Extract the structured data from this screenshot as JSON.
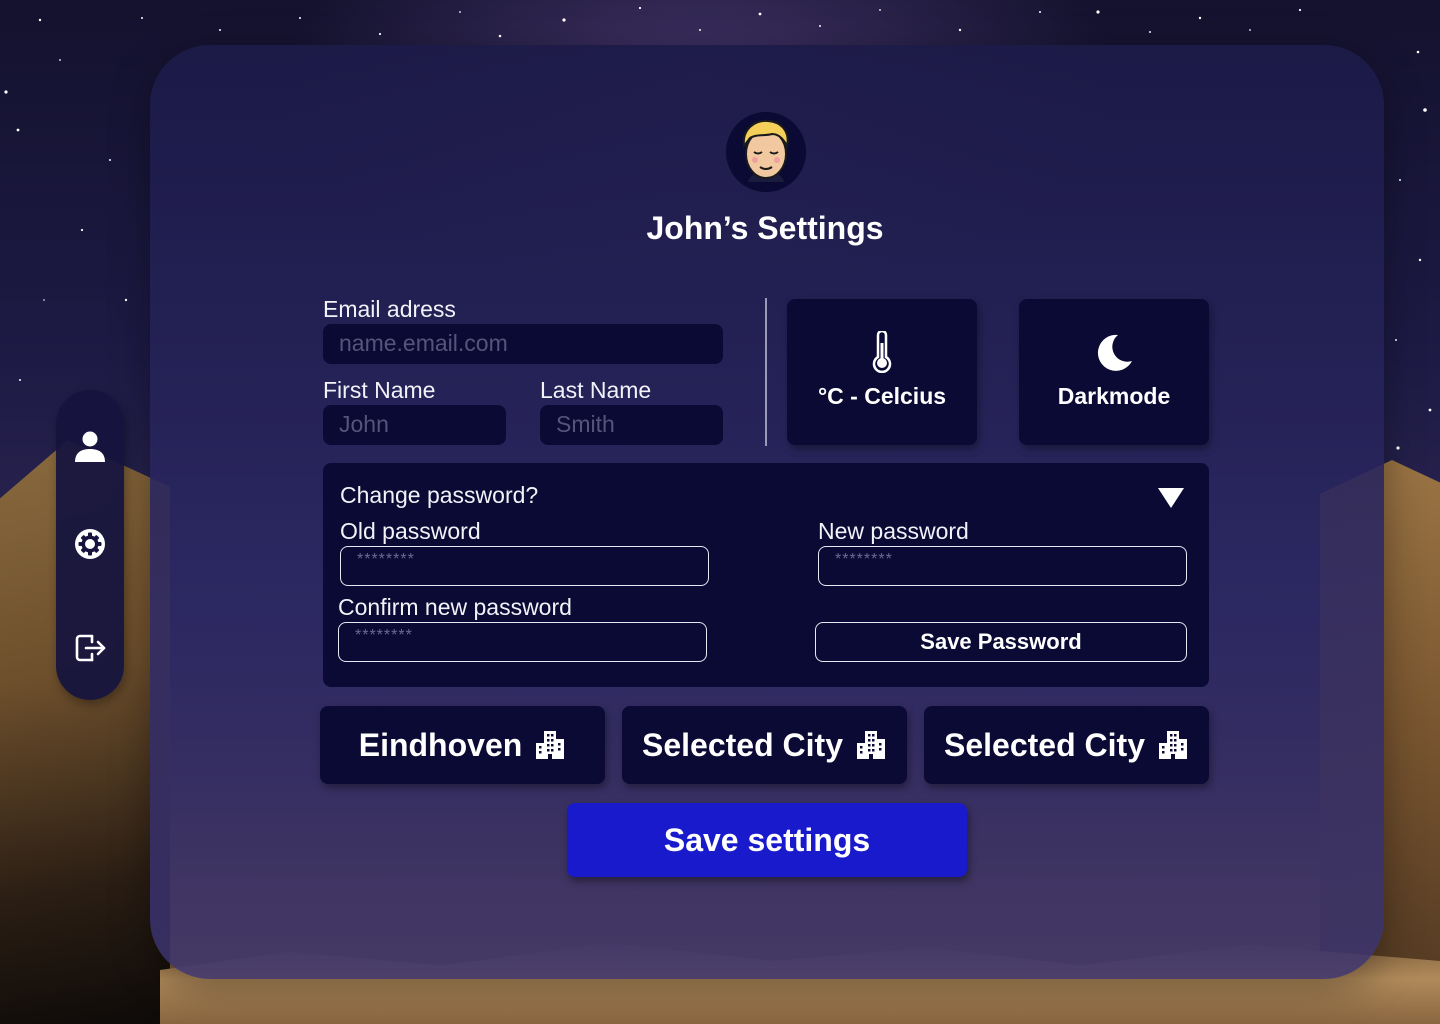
{
  "page": {
    "title": "John’s Settings"
  },
  "profile": {
    "avatar_icon": "avatar-cartoon-face"
  },
  "sidebar": {
    "items": [
      {
        "name": "profile",
        "icon": "user-icon"
      },
      {
        "name": "settings",
        "icon": "gear-icon"
      },
      {
        "name": "logout",
        "icon": "logout-icon"
      }
    ]
  },
  "form": {
    "email": {
      "label": "Email adress",
      "placeholder": "name.email.com"
    },
    "first_name": {
      "label": "First Name",
      "placeholder": "John"
    },
    "last_name": {
      "label": "Last Name",
      "placeholder": "Smith"
    }
  },
  "toggles": {
    "temperature": {
      "label": "°C - Celcius",
      "icon": "thermometer-icon"
    },
    "theme": {
      "label": "Darkmode",
      "icon": "moon-icon"
    }
  },
  "password": {
    "heading": "Change password?",
    "old_label": "Old password",
    "new_label": "New password",
    "confirm_label": "Confirm new password",
    "placeholder": "********",
    "save_label": "Save Password",
    "toggle_icon": "triangle-down-icon"
  },
  "cities": [
    {
      "label": "Eindhoven",
      "icon": "city-building-icon"
    },
    {
      "label": "Selected City",
      "icon": "city-building-icon"
    },
    {
      "label": "Selected City",
      "icon": "city-building-icon"
    }
  ],
  "actions": {
    "save_settings": "Save settings"
  },
  "colors": {
    "panel_bg": "#1c1a48",
    "field_bg": "#0b0a35",
    "primary": "#1a1acd",
    "text": "#ffffff"
  }
}
